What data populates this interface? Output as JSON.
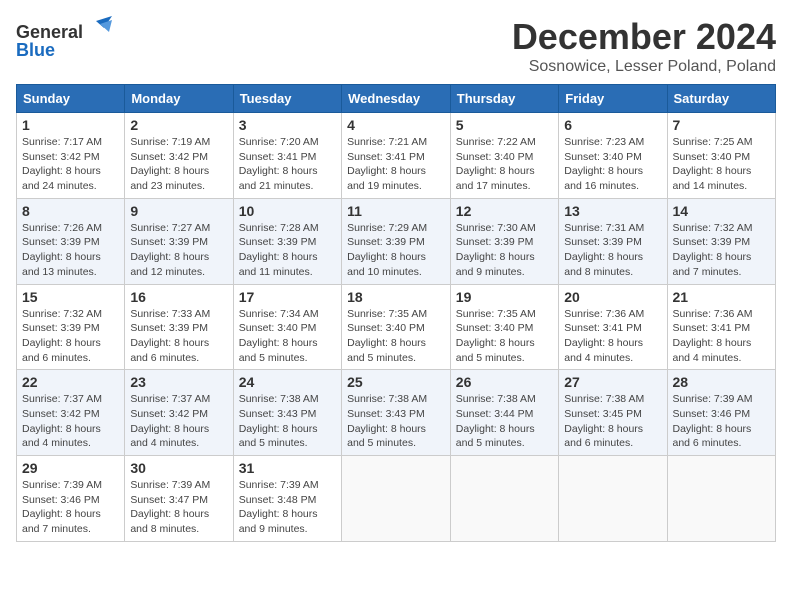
{
  "header": {
    "logo_general": "General",
    "logo_blue": "Blue",
    "month_title": "December 2024",
    "location": "Sosnowice, Lesser Poland, Poland"
  },
  "days_of_week": [
    "Sunday",
    "Monday",
    "Tuesday",
    "Wednesday",
    "Thursday",
    "Friday",
    "Saturday"
  ],
  "weeks": [
    [
      {
        "day": "1",
        "sunrise": "7:17 AM",
        "sunset": "3:42 PM",
        "daylight": "8 hours and 24 minutes."
      },
      {
        "day": "2",
        "sunrise": "7:19 AM",
        "sunset": "3:42 PM",
        "daylight": "8 hours and 23 minutes."
      },
      {
        "day": "3",
        "sunrise": "7:20 AM",
        "sunset": "3:41 PM",
        "daylight": "8 hours and 21 minutes."
      },
      {
        "day": "4",
        "sunrise": "7:21 AM",
        "sunset": "3:41 PM",
        "daylight": "8 hours and 19 minutes."
      },
      {
        "day": "5",
        "sunrise": "7:22 AM",
        "sunset": "3:40 PM",
        "daylight": "8 hours and 17 minutes."
      },
      {
        "day": "6",
        "sunrise": "7:23 AM",
        "sunset": "3:40 PM",
        "daylight": "8 hours and 16 minutes."
      },
      {
        "day": "7",
        "sunrise": "7:25 AM",
        "sunset": "3:40 PM",
        "daylight": "8 hours and 14 minutes."
      }
    ],
    [
      {
        "day": "8",
        "sunrise": "7:26 AM",
        "sunset": "3:39 PM",
        "daylight": "8 hours and 13 minutes."
      },
      {
        "day": "9",
        "sunrise": "7:27 AM",
        "sunset": "3:39 PM",
        "daylight": "8 hours and 12 minutes."
      },
      {
        "day": "10",
        "sunrise": "7:28 AM",
        "sunset": "3:39 PM",
        "daylight": "8 hours and 11 minutes."
      },
      {
        "day": "11",
        "sunrise": "7:29 AM",
        "sunset": "3:39 PM",
        "daylight": "8 hours and 10 minutes."
      },
      {
        "day": "12",
        "sunrise": "7:30 AM",
        "sunset": "3:39 PM",
        "daylight": "8 hours and 9 minutes."
      },
      {
        "day": "13",
        "sunrise": "7:31 AM",
        "sunset": "3:39 PM",
        "daylight": "8 hours and 8 minutes."
      },
      {
        "day": "14",
        "sunrise": "7:32 AM",
        "sunset": "3:39 PM",
        "daylight": "8 hours and 7 minutes."
      }
    ],
    [
      {
        "day": "15",
        "sunrise": "7:32 AM",
        "sunset": "3:39 PM",
        "daylight": "8 hours and 6 minutes."
      },
      {
        "day": "16",
        "sunrise": "7:33 AM",
        "sunset": "3:39 PM",
        "daylight": "8 hours and 6 minutes."
      },
      {
        "day": "17",
        "sunrise": "7:34 AM",
        "sunset": "3:40 PM",
        "daylight": "8 hours and 5 minutes."
      },
      {
        "day": "18",
        "sunrise": "7:35 AM",
        "sunset": "3:40 PM",
        "daylight": "8 hours and 5 minutes."
      },
      {
        "day": "19",
        "sunrise": "7:35 AM",
        "sunset": "3:40 PM",
        "daylight": "8 hours and 5 minutes."
      },
      {
        "day": "20",
        "sunrise": "7:36 AM",
        "sunset": "3:41 PM",
        "daylight": "8 hours and 4 minutes."
      },
      {
        "day": "21",
        "sunrise": "7:36 AM",
        "sunset": "3:41 PM",
        "daylight": "8 hours and 4 minutes."
      }
    ],
    [
      {
        "day": "22",
        "sunrise": "7:37 AM",
        "sunset": "3:42 PM",
        "daylight": "8 hours and 4 minutes."
      },
      {
        "day": "23",
        "sunrise": "7:37 AM",
        "sunset": "3:42 PM",
        "daylight": "8 hours and 4 minutes."
      },
      {
        "day": "24",
        "sunrise": "7:38 AM",
        "sunset": "3:43 PM",
        "daylight": "8 hours and 5 minutes."
      },
      {
        "day": "25",
        "sunrise": "7:38 AM",
        "sunset": "3:43 PM",
        "daylight": "8 hours and 5 minutes."
      },
      {
        "day": "26",
        "sunrise": "7:38 AM",
        "sunset": "3:44 PM",
        "daylight": "8 hours and 5 minutes."
      },
      {
        "day": "27",
        "sunrise": "7:38 AM",
        "sunset": "3:45 PM",
        "daylight": "8 hours and 6 minutes."
      },
      {
        "day": "28",
        "sunrise": "7:39 AM",
        "sunset": "3:46 PM",
        "daylight": "8 hours and 6 minutes."
      }
    ],
    [
      {
        "day": "29",
        "sunrise": "7:39 AM",
        "sunset": "3:46 PM",
        "daylight": "8 hours and 7 minutes."
      },
      {
        "day": "30",
        "sunrise": "7:39 AM",
        "sunset": "3:47 PM",
        "daylight": "8 hours and 8 minutes."
      },
      {
        "day": "31",
        "sunrise": "7:39 AM",
        "sunset": "3:48 PM",
        "daylight": "8 hours and 9 minutes."
      },
      null,
      null,
      null,
      null
    ]
  ],
  "labels": {
    "sunrise": "Sunrise:",
    "sunset": "Sunset:",
    "daylight": "Daylight:"
  }
}
